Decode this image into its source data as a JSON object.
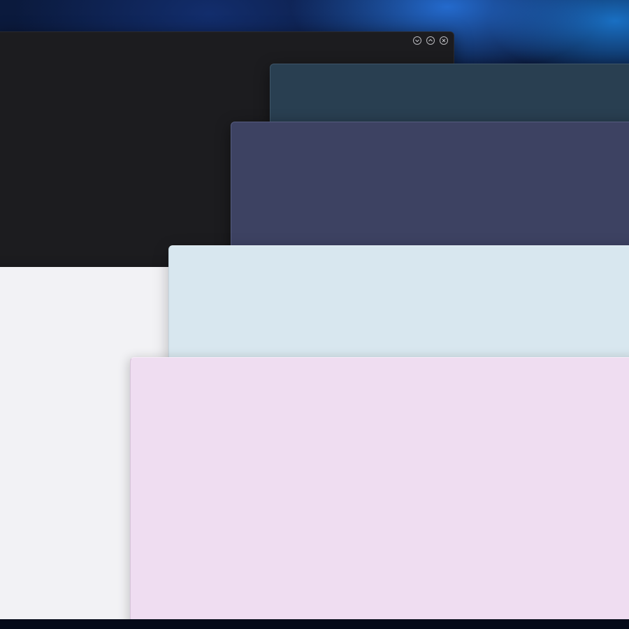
{
  "desktop": {
    "wallpaper": "blue-nebula",
    "accent": "#1e6fe0"
  },
  "windows": [
    {
      "id": "dark",
      "color": "#1c1c1f",
      "controls": [
        "minimize-icon",
        "maximize-icon",
        "close-icon"
      ]
    },
    {
      "id": "white",
      "color": "#f2f2f5"
    },
    {
      "id": "teal",
      "color": "#293f51"
    },
    {
      "id": "indigo",
      "color": "#3d4262"
    },
    {
      "id": "lightblue",
      "color": "#d8e7ef"
    },
    {
      "id": "pink",
      "color": "#efddf1"
    }
  ]
}
